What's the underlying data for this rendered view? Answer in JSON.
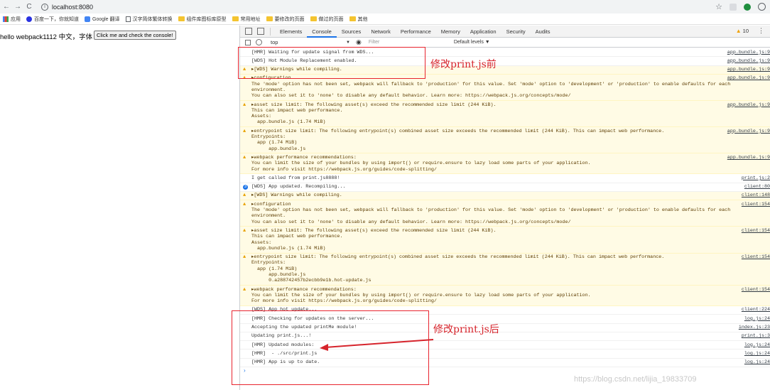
{
  "browser": {
    "url": "localhost:8080",
    "bookmarks": [
      "应用",
      "百度一下，你就知道",
      "Google 翻译",
      "汉字简体繁体转换",
      "组件库图标库原型",
      "常用地址",
      "要修改的页面",
      "做过的页面",
      "其他"
    ]
  },
  "page": {
    "text": "hello webpack1112 中文，字体",
    "button_label": "Click me and check the console!"
  },
  "devtools": {
    "tabs": [
      "Elements",
      "Console",
      "Sources",
      "Network",
      "Performance",
      "Memory",
      "Application",
      "Security",
      "Audits"
    ],
    "active_tab": "Console",
    "warning_count": "10",
    "context": "top",
    "filter_placeholder": "Filter",
    "levels": "Default levels ▼"
  },
  "console": [
    {
      "type": "log",
      "lines": [
        "[HMR] Waiting for update signal from WDS..."
      ],
      "src": "app.bundle.js:9"
    },
    {
      "type": "log",
      "lines": [
        "[WDS] Hot Module Replacement enabled."
      ],
      "src": "app.bundle.js:9"
    },
    {
      "type": "warn",
      "lines": [
        "▸[WDS] Warnings while compiling."
      ],
      "src": "app.bundle.js:9"
    },
    {
      "type": "warn",
      "lines": [
        "▸configuration",
        "The 'mode' option has not been set, webpack will fallback to 'production' for this value. Set 'mode' option to 'development' or 'production' to enable defaults for each",
        "environment.",
        "You can also set it to 'none' to disable any default behavior. Learn more: https://webpack.js.org/concepts/mode/"
      ],
      "src": "app.bundle.js:9"
    },
    {
      "type": "warn",
      "lines": [
        "▸asset size limit: The following asset(s) exceed the recommended size limit (244 KiB).",
        "This can impact web performance.",
        "Assets:",
        "  app.bundle.js (1.74 MiB)"
      ],
      "src": "app.bundle.js:9"
    },
    {
      "type": "warn",
      "lines": [
        "▸entrypoint size limit: The following entrypoint(s) combined asset size exceeds the recommended limit (244 KiB). This can impact web performance.",
        "Entrypoints:",
        "  app (1.74 MiB)",
        "      app.bundle.js"
      ],
      "src": "app.bundle.js:9"
    },
    {
      "type": "warn",
      "lines": [
        "▸webpack performance recommendations:",
        "You can limit the size of your bundles by using import() or require.ensure to lazy load some parts of your application.",
        "For more info visit https://webpack.js.org/guides/code-splitting/"
      ],
      "src": "app.bundle.js:9"
    },
    {
      "type": "log",
      "lines": [
        "I get called from print.js8888!"
      ],
      "src": "print.js:2"
    },
    {
      "type": "info",
      "lines": [
        "[WDS] App updated. Recompiling..."
      ],
      "src": "client:80"
    },
    {
      "type": "warn",
      "lines": [
        "▸[WDS] Warnings while compiling."
      ],
      "src": "client:148"
    },
    {
      "type": "warn",
      "lines": [
        "▸configuration",
        "The 'mode' option has not been set, webpack will fallback to 'production' for this value. Set 'mode' option to 'development' or 'production' to enable defaults for each",
        "environment.",
        "You can also set it to 'none' to disable any default behavior. Learn more: https://webpack.js.org/concepts/mode/"
      ],
      "src": "client:154"
    },
    {
      "type": "warn",
      "lines": [
        "▸asset size limit: The following asset(s) exceed the recommended size limit (244 KiB).",
        "This can impact web performance.",
        "Assets:",
        "  app.bundle.js (1.74 MiB)"
      ],
      "src": "client:154"
    },
    {
      "type": "warn",
      "lines": [
        "▸entrypoint size limit: The following entrypoint(s) combined asset size exceeds the recommended limit (244 KiB). This can impact web performance.",
        "Entrypoints:",
        "  app (1.74 MiB)",
        "      app.bundle.js",
        "      0.a288742457b2ecbb9e1b.hot-update.js"
      ],
      "src": "client:154"
    },
    {
      "type": "warn",
      "lines": [
        "▸webpack performance recommendations:",
        "You can limit the size of your bundles by using import() or require.ensure to lazy load some parts of your application.",
        "For more info visit https://webpack.js.org/guides/code-splitting/"
      ],
      "src": "client:154"
    },
    {
      "type": "log",
      "lines": [
        "[WDS] App hot update..."
      ],
      "src": "client:224"
    },
    {
      "type": "log",
      "lines": [
        "[HMR] Checking for updates on the server..."
      ],
      "src": "log.js:24"
    },
    {
      "type": "log",
      "lines": [
        "Accepting the updated printMe module!"
      ],
      "src": "index.js:23"
    },
    {
      "type": "log",
      "lines": [
        "Updating print.js...!"
      ],
      "src": "print.js:3"
    },
    {
      "type": "log",
      "lines": [
        "[HMR] Updated modules:"
      ],
      "src": "log.js:24"
    },
    {
      "type": "log",
      "lines": [
        "[HMR]  - ./src/print.js"
      ],
      "src": "log.js:24"
    },
    {
      "type": "log",
      "lines": [
        "[HMR] App is up to date."
      ],
      "src": "log.js:24"
    }
  ],
  "annotations": {
    "before": "修改print.js前",
    "after": "修改print.js后"
  },
  "watermark": "https://blog.csdn.net/lijia_19833709"
}
